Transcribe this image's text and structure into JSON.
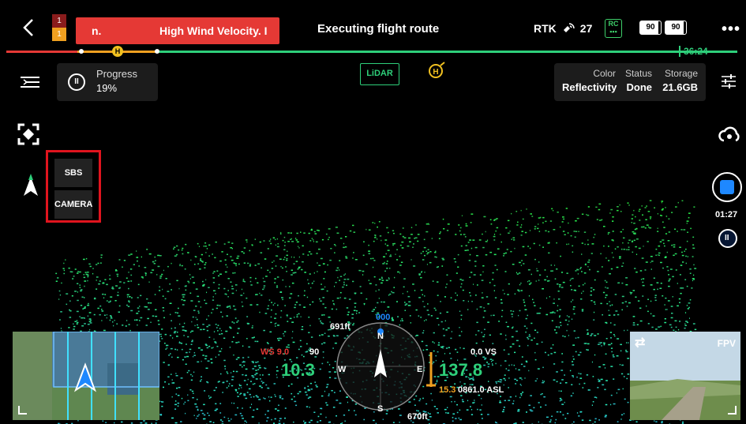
{
  "top_bar": {
    "alert_counts": [
      "1",
      "1"
    ],
    "alert_fragment": "n.",
    "alert_message": "High Wind Velocity. I",
    "flight_status": "Executing flight route",
    "rtk_label": "RTK",
    "satellite_count": "27",
    "rc_label": "RC",
    "battery_left": "90",
    "battery_right": "90",
    "more_label": "•••"
  },
  "route_progress": {
    "home_label": "H",
    "remaining_time": "36:24",
    "completed_fraction": 0.2
  },
  "progress_card": {
    "label": "Progress",
    "value": "19%",
    "pause_glyph": "II"
  },
  "lidar_button": "LiDAR",
  "home_marker": "H",
  "info_card": {
    "color_label": "Color",
    "color_value": "Reflectivity",
    "status_label": "Status",
    "status_value": "Done",
    "storage_label": "Storage",
    "storage_value": "21.6GB"
  },
  "view_switch": {
    "options": [
      "SBS",
      "CAMERA"
    ]
  },
  "recording": {
    "time": "01:27",
    "pause_glyph": "II"
  },
  "attitude": {
    "height_top": "691ft",
    "height_bottom": "670ft",
    "compass_n": "N",
    "compass_e": "E",
    "compass_s": "S",
    "compass_w": "W",
    "heading_marker": "000",
    "wind_speed": "WS 9.0",
    "wind_dir": "90",
    "horizontal_speed": "10.3",
    "vertical_speed": "0.0 VS",
    "altitude": "137.8",
    "asl": "0861.0 ASL",
    "distance": "15.3"
  },
  "fpv": {
    "label": "FPV",
    "swap_glyph": "⇄"
  },
  "colors": {
    "alert_red": "#e53935",
    "route_green": "#2ecf7a",
    "accent_blue": "#1e88ff",
    "highlight_box": "#e0141e",
    "warning_orange": "#f0a020"
  }
}
